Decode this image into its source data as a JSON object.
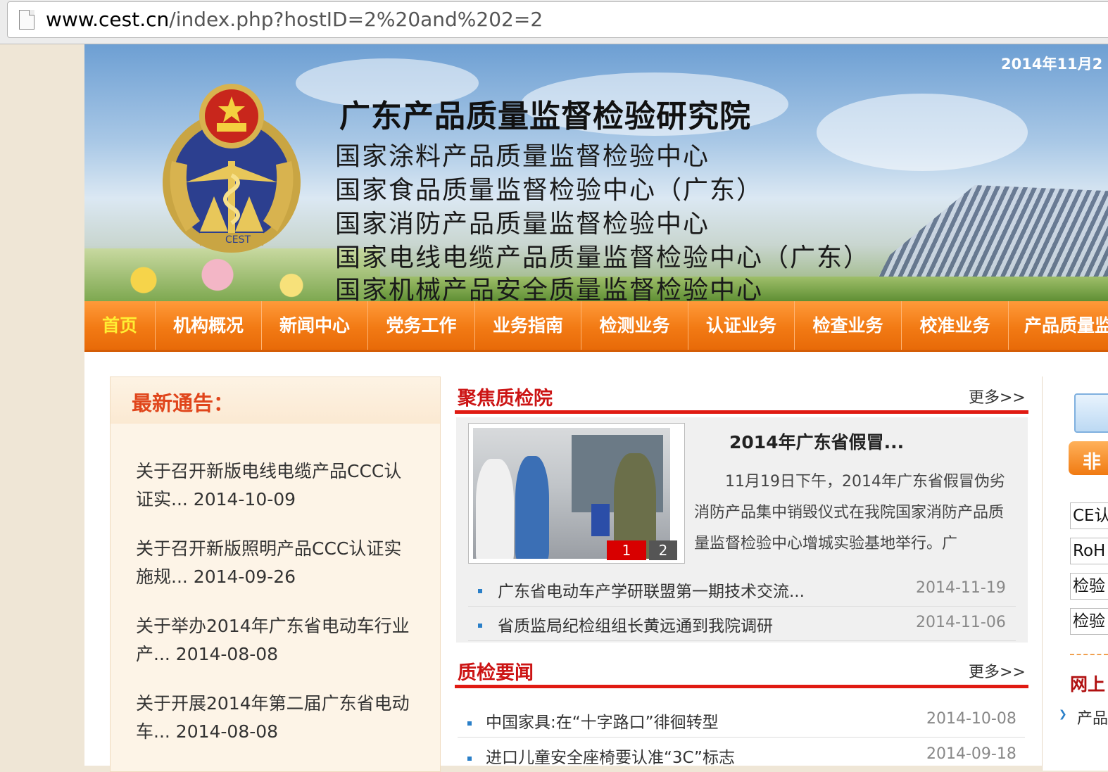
{
  "browser": {
    "url_host": "www.cest.cn",
    "url_path": "/index.php?hostID=2%20and%202=2"
  },
  "banner": {
    "date": "2014年11月2",
    "title": "广东产品质量监督检验研究院",
    "centers": [
      "国家涂料产品质量监督检验中心",
      "国家食品质量监督检验中心（广东）",
      "国家消防产品质量监督检验中心",
      "国家电线电缆产品质量监督检验中心（广东）",
      "国家机械产品安全质量监督检验中心"
    ]
  },
  "nav": [
    {
      "label": "首页",
      "active": true
    },
    {
      "label": "机构概况"
    },
    {
      "label": "新闻中心"
    },
    {
      "label": "党务工作"
    },
    {
      "label": "业务指南"
    },
    {
      "label": "检测业务"
    },
    {
      "label": "认证业务"
    },
    {
      "label": "检查业务"
    },
    {
      "label": "校准业务"
    },
    {
      "label": "产品质量监"
    }
  ],
  "notices": {
    "title": "最新通告：",
    "items": [
      {
        "line1": "关于召开新版电线电缆产品CCC认",
        "line2": "证实... 2014-10-09"
      },
      {
        "line1": "关于召开新版照明产品CCC认证实",
        "line2": "施规... 2014-09-26"
      },
      {
        "line1": "关于举办2014年广东省电动车行业",
        "line2": "产... 2014-08-08"
      },
      {
        "line1": "关于开展2014年第二届广东省电动",
        "line2": "车... 2014-08-08"
      }
    ]
  },
  "focus": {
    "title": "聚焦质检院",
    "more": "更多>>",
    "pager": [
      "1",
      "2"
    ],
    "feature_title": "2014年广东省假冒...",
    "feature_text": "11月19日下午，2014年广东省假冒伪劣消防产品集中销毁仪式在我院国家消防产品质量监督检验中心增城实验基地举行。广",
    "news": [
      {
        "title": "广东省电动车产学研联盟第一期技术交流...",
        "date": "2014-11-19"
      },
      {
        "title": "省质监局纪检组组长黄远通到我院调研",
        "date": "2014-11-06"
      }
    ]
  },
  "qnews": {
    "title": "质检要闻",
    "more": "更多>>",
    "items": [
      {
        "title": "中国家具:在“十字路口”徘徊转型",
        "date": "2014-10-08"
      },
      {
        "title": "进口儿童安全座椅要认准“3C”标志",
        "date": "2014-09-18"
      }
    ]
  },
  "right": {
    "button_label": "非",
    "boxes": [
      "CE认",
      "RoH",
      "检验",
      "检验"
    ],
    "online": "网上",
    "product": "产品"
  },
  "colors": {
    "nav_orange": "#f27a14",
    "accent_red": "#e01a12",
    "notice_title": "#e0451b"
  }
}
